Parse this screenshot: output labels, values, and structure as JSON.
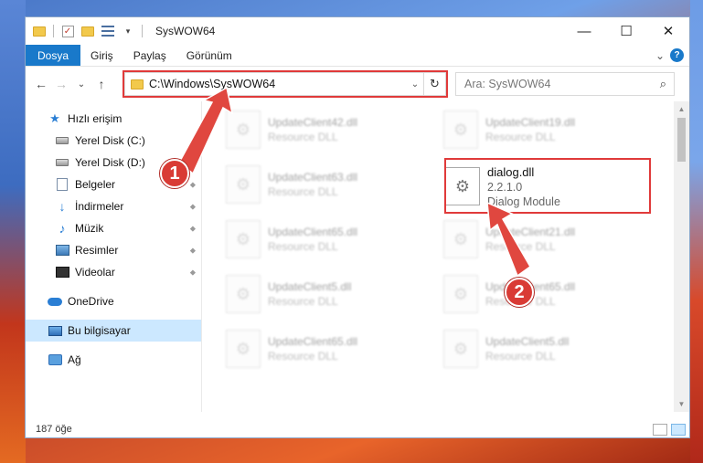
{
  "window": {
    "title": "SysWOW64",
    "controls": {
      "minimize": "—",
      "maximize": "☐",
      "close": "✕"
    }
  },
  "ribbon": {
    "tabs": [
      "Dosya",
      "Giriş",
      "Paylaş",
      "Görünüm"
    ],
    "expand": "⌄",
    "help": "?"
  },
  "nav": {
    "back": "←",
    "forward": "→",
    "recent": "⌄",
    "up": "↑",
    "address": "C:\\Windows\\SysWOW64",
    "address_dropdown": "⌄",
    "refresh": "↻",
    "search_placeholder": "Ara: SysWOW64",
    "search_icon": "⌕"
  },
  "sidebar": {
    "items": [
      {
        "label": "Hızlı erişim",
        "icon": "star-icon",
        "pinned": false
      },
      {
        "label": "Yerel Disk (C:)",
        "icon": "disk-icon",
        "pinned": true
      },
      {
        "label": "Yerel Disk (D:)",
        "icon": "disk-icon",
        "pinned": true
      },
      {
        "label": "Belgeler",
        "icon": "document-icon",
        "pinned": true
      },
      {
        "label": "İndirmeler",
        "icon": "download-icon",
        "pinned": true
      },
      {
        "label": "Müzik",
        "icon": "music-icon",
        "pinned": true
      },
      {
        "label": "Resimler",
        "icon": "pictures-icon",
        "pinned": true
      },
      {
        "label": "Videolar",
        "icon": "video-icon",
        "pinned": true
      },
      {
        "label": "OneDrive",
        "icon": "cloud-icon",
        "pinned": false
      },
      {
        "label": "Bu bilgisayar",
        "icon": "computer-icon",
        "pinned": false
      },
      {
        "label": "Ağ",
        "icon": "network-icon",
        "pinned": false
      }
    ],
    "pin_glyph": "📌"
  },
  "files": {
    "left_column": [
      {
        "name": "UpdateClient42.dll",
        "desc": "Resource DLL"
      },
      {
        "name": "UpdateClient63.dll",
        "desc": "Resource DLL"
      },
      {
        "name": "UpdateClient65.dll",
        "desc": "Resource DLL"
      },
      {
        "name": "UpdateClient5.dll",
        "desc": "Resource DLL"
      },
      {
        "name": "UpdateClient65.dll",
        "desc": "Resource DLL"
      }
    ],
    "right_column": [
      {
        "name": "UpdateClient19.dll",
        "desc": "Resource DLL"
      },
      {
        "name": "UpdateClient21.dll",
        "desc": "Resource DLL"
      },
      {
        "name": "UpdateClient65.dll",
        "desc": "Resource DLL"
      },
      {
        "name": "UpdateClient5.dll",
        "desc": "Resource DLL"
      }
    ],
    "focused": {
      "name": "dialog.dll",
      "version": "2.2.1.0",
      "desc": "Dialog Module"
    }
  },
  "callouts": {
    "step1": "1",
    "step2": "2"
  },
  "status": {
    "count": "187 öğe"
  },
  "colors": {
    "accent": "#1979ca",
    "highlight": "#e03a3a",
    "selected": "#cce8ff"
  }
}
